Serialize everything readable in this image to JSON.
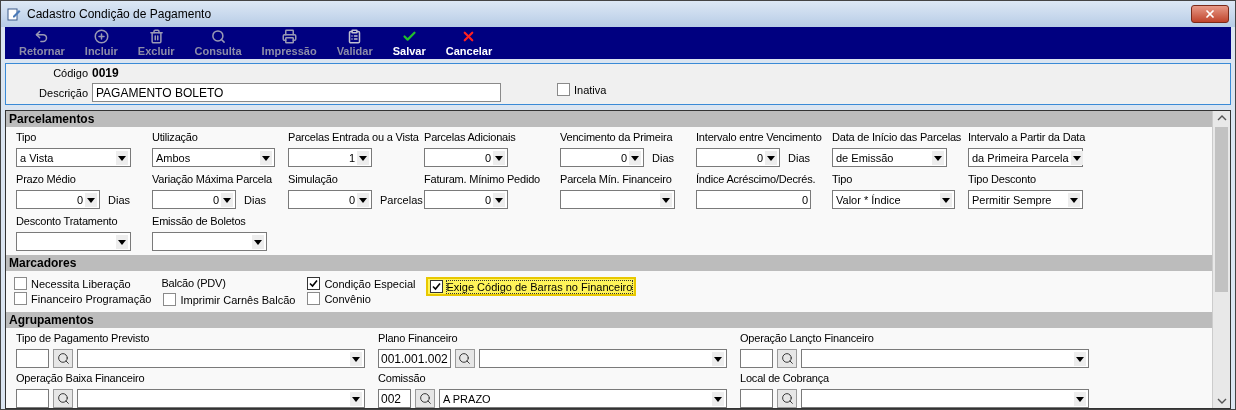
{
  "window": {
    "title": "Cadastro Condição de Pagamento"
  },
  "toolbar": [
    {
      "label": "Retornar",
      "kind": "back",
      "disabled": true
    },
    {
      "label": "Incluir",
      "kind": "add",
      "disabled": true
    },
    {
      "label": "Excluir",
      "kind": "delete",
      "disabled": true
    },
    {
      "label": "Consulta",
      "kind": "search",
      "disabled": true
    },
    {
      "label": "Impressão",
      "kind": "print",
      "disabled": true
    },
    {
      "label": "Validar",
      "kind": "validate",
      "disabled": true
    },
    {
      "label": "Salvar",
      "kind": "save",
      "disabled": false
    },
    {
      "label": "Cancelar",
      "kind": "cancel",
      "disabled": false
    }
  ],
  "header": {
    "code_label": "Código",
    "code": "0019",
    "description_label": "Descrição",
    "description": "PAGAMENTO BOLETO",
    "inactive": {
      "label": "Inativa",
      "checked": false
    }
  },
  "parcelamentos": {
    "title": "Parcelamentos",
    "fields": [
      {
        "label": "Tipo",
        "kind": "combo",
        "value": "a Vista"
      },
      {
        "label": "Utilização",
        "kind": "combo",
        "value": "Ambos"
      },
      {
        "label": "Parcelas Entrada ou a Vista",
        "kind": "spin",
        "value": "1"
      },
      {
        "label": "Parcelas Adicionais",
        "kind": "spin",
        "value": "0"
      },
      {
        "label": "Vencimento da Primeira",
        "kind": "spin",
        "value": "0",
        "suffix": "Dias"
      },
      {
        "label": "Intervalo entre Vencimento",
        "kind": "spin",
        "value": "0",
        "suffix": "Dias"
      },
      {
        "label": "Data de Início das Parcelas",
        "kind": "combo",
        "value": "de Emissão"
      },
      {
        "label": "Intervalo a Partir da Data",
        "kind": "combo",
        "value": "da Primeira Parcela"
      },
      {
        "label": "Prazo Médio",
        "kind": "spin",
        "value": "0",
        "suffix": "Dias"
      },
      {
        "label": "Variação Máxima Parcela",
        "kind": "spin",
        "value": "0",
        "suffix": "Dias"
      },
      {
        "label": "Simulação",
        "kind": "spin",
        "value": "0",
        "suffix": "Parcelas"
      },
      {
        "label": "Faturam. Mínimo Pedido",
        "kind": "spin",
        "value": "0"
      },
      {
        "label": "Parcela Mín. Financeiro",
        "kind": "combo"
      },
      {
        "label": "Índice Acréscimo/Decrés.",
        "kind": "input",
        "value": "0"
      },
      {
        "label": "Tipo",
        "kind": "combo",
        "value": "Valor * Índice"
      },
      {
        "label": "Tipo Desconto",
        "kind": "combo",
        "value": "Permitir Sempre"
      },
      {
        "label": "Desconto Tratamento",
        "kind": "combo"
      },
      {
        "label": "Emissão de Boletos",
        "kind": "combo"
      }
    ]
  },
  "marcadores": {
    "title": "Marcadores",
    "columns": [
      {
        "items": [
          {
            "label": "Necessita Liberação",
            "checked": false,
            "focused": false
          },
          {
            "label": "Financeiro Programação",
            "checked": false,
            "focused": false
          }
        ]
      },
      {
        "heading": "Balcão (PDV)",
        "items": [
          {
            "label": "Imprimir Carnês Balcão",
            "checked": false,
            "focused": false
          }
        ]
      },
      {
        "items": [
          {
            "label": "Condição Especial",
            "checked": true,
            "focused": false
          },
          {
            "label": "Convênio",
            "checked": false,
            "focused": false
          }
        ]
      },
      {
        "items": [
          {
            "label": "Exige Código de Barras no Financeiro",
            "checked": true,
            "focused": true
          }
        ]
      }
    ]
  },
  "agrupamentos": {
    "title": "Agrupamentos",
    "fields": [
      {
        "label": "Tipo de Pagamento Previsto"
      },
      {
        "label": "Plano Financeiro",
        "code": "001.001.002"
      },
      {
        "label": "Operação Lançto Financeiro"
      },
      {
        "label": "Operação Baixa Financeiro"
      },
      {
        "label": "Comissão",
        "code": "002",
        "value": "A PRAZO"
      },
      {
        "label": "Local de Cobrança"
      }
    ]
  }
}
